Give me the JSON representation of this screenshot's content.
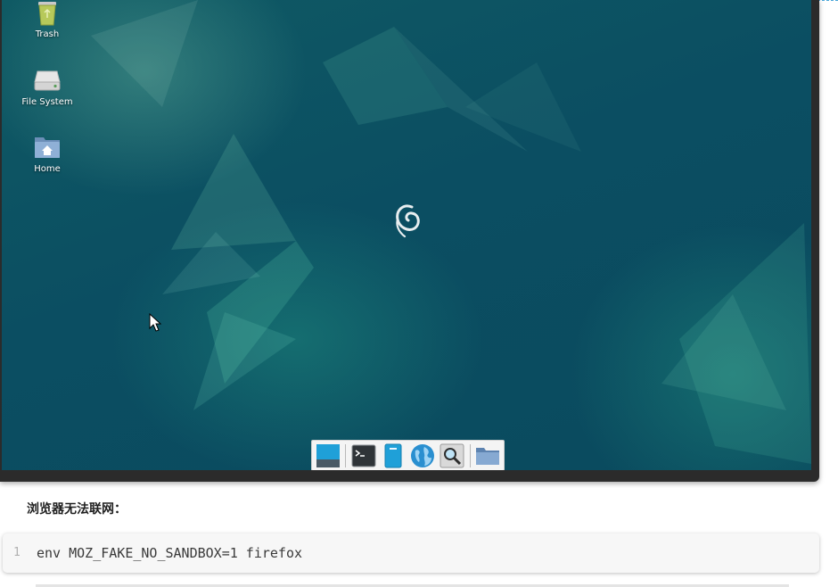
{
  "desktop": {
    "icons": [
      {
        "label": "Trash",
        "icon": "trash-icon"
      },
      {
        "label": "File System",
        "icon": "drive-icon"
      },
      {
        "label": "Home",
        "icon": "home-folder-icon"
      }
    ],
    "center_logo": "debian-swirl-icon",
    "dock": [
      {
        "name": "show-desktop",
        "icon": "show-desktop-icon"
      },
      {
        "name": "terminal",
        "icon": "terminal-icon"
      },
      {
        "name": "file-manager",
        "icon": "file-manager-icon"
      },
      {
        "name": "web-browser",
        "icon": "globe-icon"
      },
      {
        "name": "app-finder",
        "icon": "magnifier-icon"
      },
      {
        "name": "folder",
        "icon": "folder-icon"
      }
    ],
    "colors": {
      "background": "#0b4e62",
      "accent": "#1fa0d8"
    }
  },
  "doc": {
    "caption": "浏览器无法联网：",
    "code": {
      "line_number": "1",
      "text": "env MOZ_FAKE_NO_SANDBOX=1 firefox"
    }
  }
}
